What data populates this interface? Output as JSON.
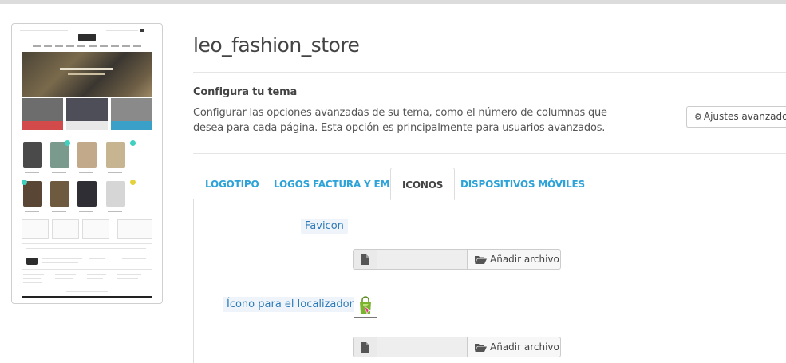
{
  "theme": {
    "name": "leo_fashion_store"
  },
  "configure": {
    "heading": "Configura tu tema",
    "description": "Configurar las opciones avanzadas de su tema, como el número de columnas que desea para cada página. Esta opción es principalmente para usuarios avanzados.",
    "advanced_button": "Ajustes avanzados"
  },
  "tabs": [
    {
      "label": "LOGOTIPO",
      "active": false
    },
    {
      "label": "LOGOS FACTURA Y EMAIL",
      "active": false
    },
    {
      "label": "ICONOS",
      "active": true
    },
    {
      "label": "DISPOSITIVOS MÓVILES",
      "active": false
    }
  ],
  "fields": {
    "favicon": {
      "label": "Favicon",
      "button": "Añadir archivo",
      "value": ""
    },
    "store_icon": {
      "label": "Ícono para el localizador",
      "button": "Añadir archivo",
      "value": ""
    }
  },
  "colors": {
    "tab_link": "#2ea3d8",
    "label_text": "#2e7ab8",
    "label_bg": "#eef4f9",
    "store_icon_green": "#7ab32e",
    "store_icon_pink": "#e0307a"
  },
  "icons": {
    "gear": "gear-icon",
    "file": "file-icon",
    "folder": "folder-open-icon",
    "store": "shopping-bag-icon"
  }
}
